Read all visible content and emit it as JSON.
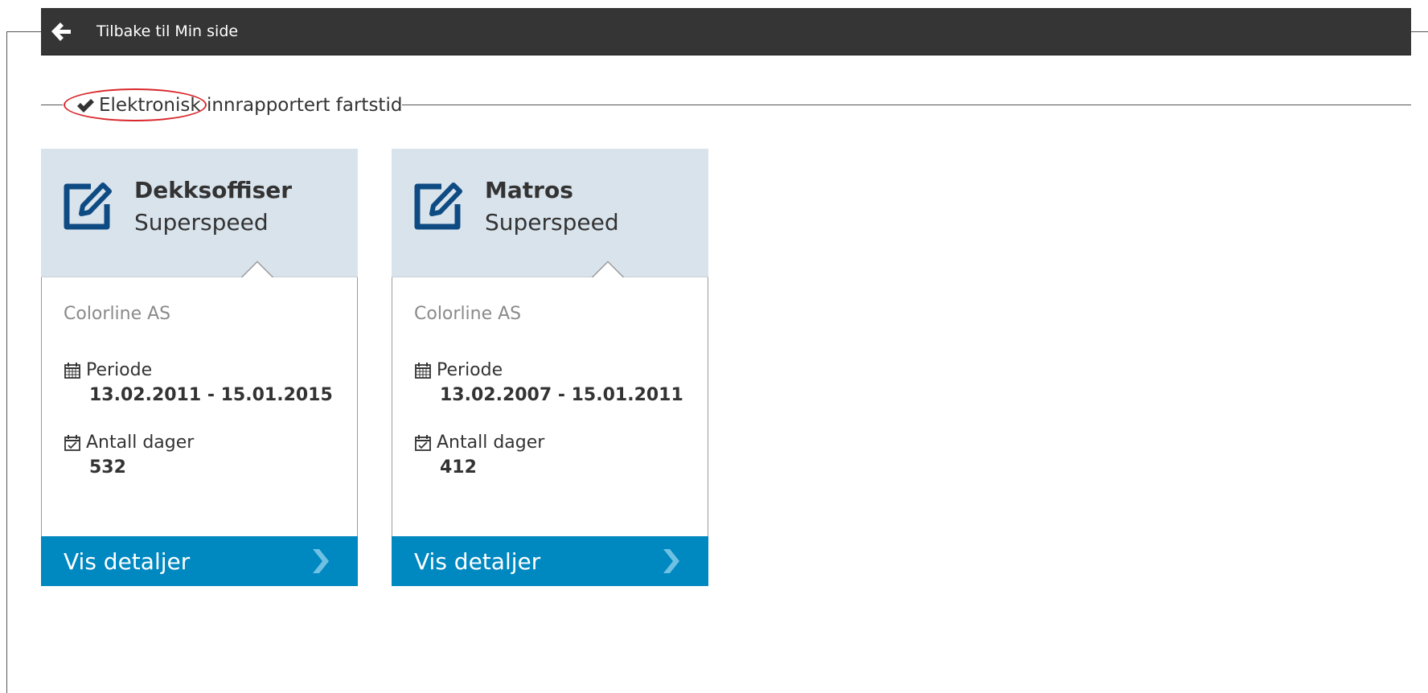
{
  "header": {
    "back_label": "Tilbake til Min side"
  },
  "section": {
    "title": "Elektronisk innrapportert fartstid"
  },
  "cards": [
    {
      "title": "Dekksoffiser",
      "subtitle": "Superspeed",
      "company": "Colorline AS",
      "period_label": "Periode",
      "period_value": "13.02.2011 - 15.01.2015",
      "days_label": "Antall dager",
      "days_value": "532",
      "details_label": "Vis detaljer"
    },
    {
      "title": "Matros",
      "subtitle": "Superspeed",
      "company": "Colorline AS",
      "period_label": "Periode",
      "period_value": "13.02.2007 - 15.01.2011",
      "days_label": "Antall dager",
      "days_value": "412",
      "details_label": "Vis detaljer"
    }
  ],
  "icons": {
    "back": "arrow-left-icon",
    "section": "check-icon",
    "card": "edit-icon",
    "period": "calendar-icon",
    "days": "calendar-check-icon",
    "details": "chevron-right-icon"
  },
  "colors": {
    "topbar_bg": "#353535",
    "card_header_bg": "#d9e3ec",
    "edit_icon": "#0f4b83",
    "footer_bg": "#0088c0",
    "annotation": "#d9262b"
  }
}
